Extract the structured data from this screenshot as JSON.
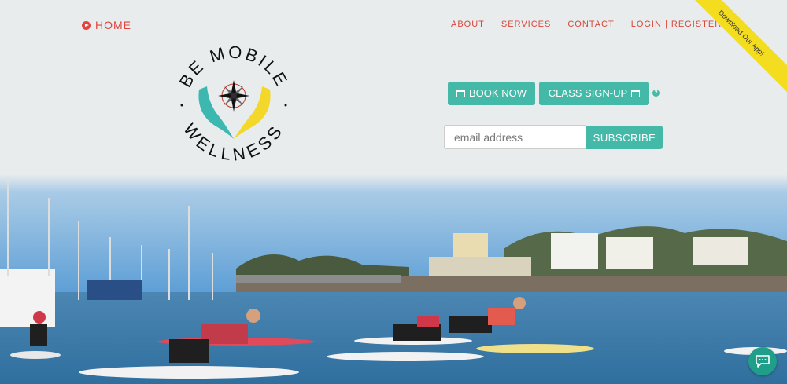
{
  "header": {
    "home_label": "HOME",
    "nav": {
      "about": "ABOUT",
      "services": "SERVICES",
      "contact": "CONTACT",
      "login": "LOGIN | REGISTER"
    }
  },
  "ribbon": {
    "label": "Download Our App!"
  },
  "logo": {
    "top_text": "BE MOBILE",
    "bottom_text": "WELLNESS"
  },
  "booking": {
    "book_label": "BOOK NOW",
    "class_label": "CLASS SIGN-UP"
  },
  "newsletter": {
    "placeholder": "email address",
    "value": "",
    "subscribe_label": "SUBSCRIBE"
  },
  "colors": {
    "accent": "#45b9a7",
    "nav_red": "#d8473c",
    "ribbon_yellow": "#f4dd1f"
  },
  "icons": {
    "home": "play-circle-icon",
    "help": "question-circle-icon",
    "calendar": "calendar-icon",
    "chat": "chat-bubble-icon"
  }
}
